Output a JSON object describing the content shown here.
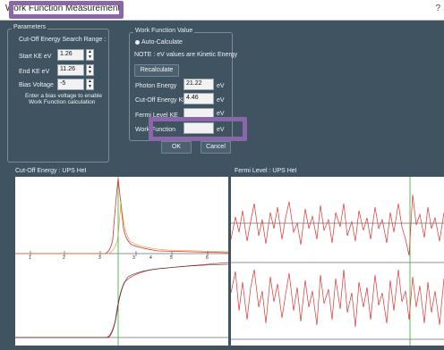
{
  "window": {
    "title": "Work Function Measurement",
    "close_glyph": "?"
  },
  "parameters": {
    "group_title": "Parameters",
    "search_range_label": "Cut-Off Energy Search Range :",
    "start_ke_label": "Start KE eV",
    "start_ke_value": "1.26",
    "end_ke_label": "End KE eV",
    "end_ke_value": "11.26",
    "bias_label": "Bias Voltage",
    "bias_value": "-5",
    "bias_note_1": "Enter a bias voltage to enable",
    "bias_note_2": "Work Function calculation"
  },
  "workfunction": {
    "group_title": "Work Function Value",
    "auto_calculate": "Auto-Calculate",
    "note": "NOTE : eV values are Kinetic Energy",
    "recalculate": "Recalculate",
    "photon_energy_label": "Photon Energy",
    "photon_energy_value": "21.22",
    "cutoff_label": "Cut-Off Energy KE",
    "cutoff_value": "4.46",
    "fermi_label": "Fermi Level KE",
    "fermi_value": "",
    "work_function_label": "Work Function",
    "work_function_value": "",
    "unit": "eV"
  },
  "dialog_buttons": {
    "ok": "OK",
    "cancel": "Cancel"
  },
  "plots": {
    "cutoff_title": "Cut-Off Energy : UPS HeI",
    "fermi_title": "Fermi Level : UPS HeI",
    "colors": {
      "spectrum": "#e03030",
      "marker": "#2fae2f",
      "axis": "#222222"
    },
    "cutoff_tick_labels": [
      "1",
      "2",
      "3",
      "3",
      "4",
      "5",
      "6"
    ]
  }
}
